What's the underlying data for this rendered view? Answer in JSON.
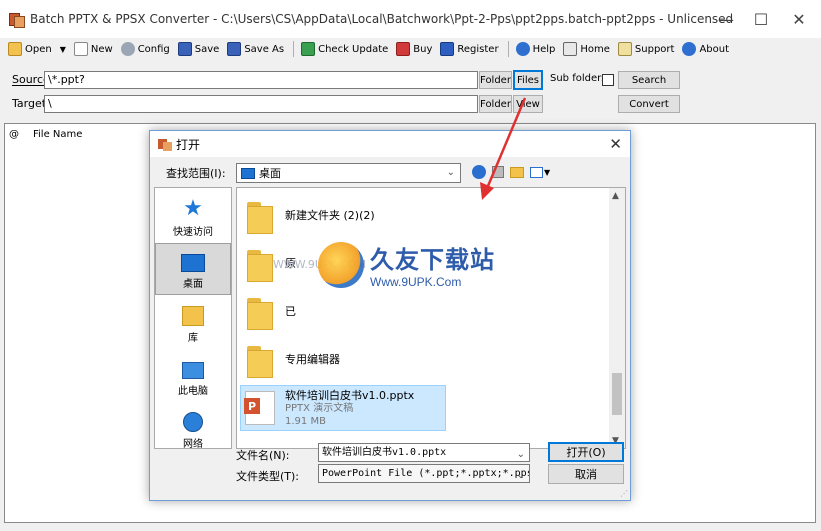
{
  "window": {
    "title": "Batch PPTX & PPSX Converter - C:\\Users\\CS\\AppData\\Local\\Batchwork\\Ppt-2-Pps\\ppt2pps.batch-ppt2pps - Unlicensed",
    "minimize": "—",
    "maximize": "☐",
    "close": "✕"
  },
  "toolbar": {
    "open": "Open",
    "open_dropdown": "▼",
    "new": "New",
    "config": "Config",
    "save": "Save",
    "save_as": "Save As",
    "check_update": "Check Update",
    "buy": "Buy",
    "register": "Register",
    "help": "Help",
    "home": "Home",
    "support": "Support",
    "about": "About"
  },
  "source": {
    "label": "Source",
    "value": "\\*.ppt?",
    "folder_button": "Folder",
    "files_button": "Files",
    "subfolders_label": "Sub folders",
    "search_button": "Search"
  },
  "target": {
    "label": "Target",
    "value": "\\",
    "folder_button": "Folder",
    "view_button": "View",
    "convert_button": "Convert"
  },
  "list": {
    "col_at": "@",
    "col_name": "File Name"
  },
  "dialog": {
    "title": "打开",
    "close": "✕",
    "look_in_label": "查找范围(I):",
    "look_in_value": "桌面",
    "places": [
      {
        "label": "快速访问"
      },
      {
        "label": "桌面"
      },
      {
        "label": "库"
      },
      {
        "label": "此电脑"
      },
      {
        "label": "网络"
      }
    ],
    "files": [
      {
        "name": "新建文件夹 (2)(2)"
      },
      {
        "name": "原"
      },
      {
        "name": "已"
      },
      {
        "name": "专用编辑器"
      }
    ],
    "selected_file": {
      "name": "软件培训白皮书v1.0.pptx",
      "type": "PPTX 演示文稿",
      "size": "1.91 MB"
    },
    "filename_label": "文件名(N):",
    "filename_value": "软件培训白皮书v1.0.pptx",
    "filetype_label": "文件类型(T):",
    "filetype_value": "PowerPoint File (*.ppt;*.pptx;*.pps;*",
    "open_button": "打开(O)",
    "cancel_button": "取消"
  },
  "watermark": {
    "main": "久友下载站",
    "url": "Www.9UPK.Com",
    "faint": "WWW.9UPK.COM"
  },
  "colors": {
    "accent": "#0078d7",
    "arrow": "#e03030",
    "selected": "#cce8ff"
  }
}
